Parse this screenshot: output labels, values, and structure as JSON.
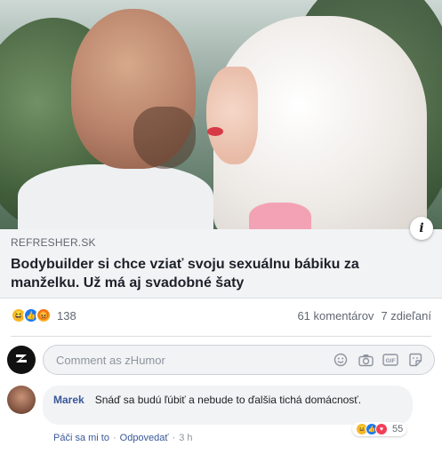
{
  "post": {
    "image_alt": "Bodybuilder and doll",
    "link": {
      "domain": "REFRESHER.SK",
      "title": "Bodybuilder si chce vziať svoju sexuálnu bábiku za manželku. Už má aj svadobné šaty"
    },
    "reactions": {
      "types": [
        "haha",
        "like",
        "angry"
      ],
      "count": "138"
    },
    "comments_count": "61 komentárov",
    "shares_count": "7 zdieľaní"
  },
  "composer": {
    "avatar_letter": "z",
    "placeholder": "Comment as zHumor",
    "tools": [
      "emoji-icon",
      "camera-icon",
      "gif-icon",
      "sticker-icon"
    ]
  },
  "comment": {
    "author": "Marek",
    "text": "Snáď sa budú ľúbiť a nebude to ďalšia tichá domácnosť.",
    "like_label": "Páči sa mi to",
    "separator": "·",
    "reply_label": "Odpovedať",
    "time": "3 h",
    "reaction_count": "55"
  },
  "colors": {
    "link_blue": "#385898",
    "like_blue": "#1877f2",
    "haha_yellow": "#f7b928",
    "love_red": "#f33e58"
  }
}
